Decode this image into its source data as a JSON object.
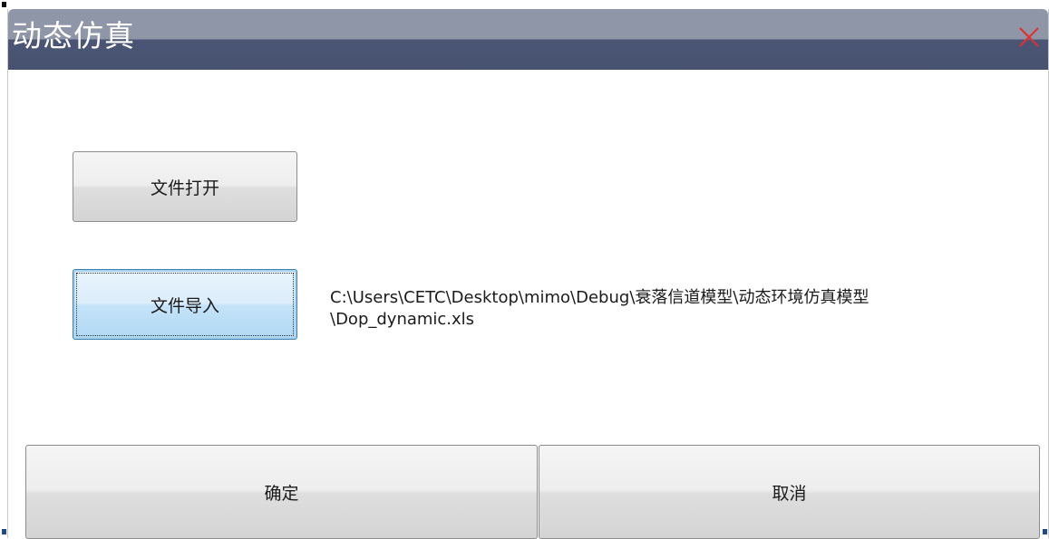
{
  "window": {
    "title": "动态仿真"
  },
  "titlebar": {
    "close_icon": "close-icon",
    "close_color": "#e03030"
  },
  "buttons": {
    "open_label": "文件打开",
    "import_label": "文件导入",
    "ok_label": "确定",
    "cancel_label": "取消"
  },
  "file": {
    "path": "C:\\Users\\CETC\\Desktop\\mimo\\Debug\\衰落信道模型\\动态环境仿真模型\\Dop_dynamic.xls"
  }
}
